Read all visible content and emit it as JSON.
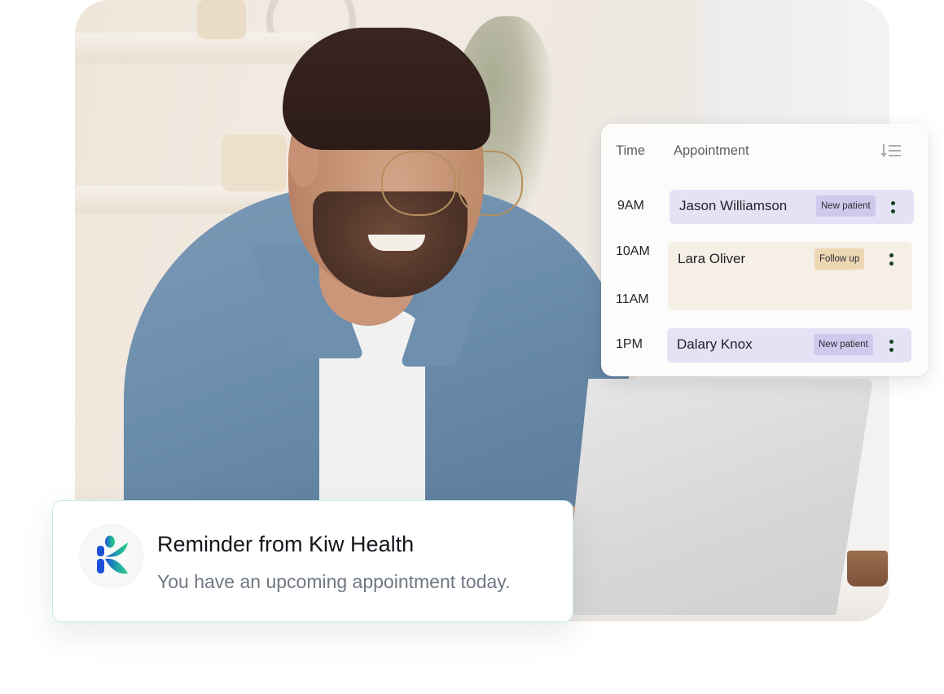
{
  "schedule": {
    "headers": {
      "time": "Time",
      "appointment": "Appointment"
    },
    "sort_icon": "sort-descending-icon",
    "time_labels": [
      "9AM",
      "10AM",
      "11AM",
      "1PM"
    ],
    "appointments": [
      {
        "time": "9AM",
        "patient": "Jason Williamson",
        "tag": "New patient",
        "tag_color": "#d0c9ec",
        "row_color": "#e4e2f5"
      },
      {
        "time": "10AM",
        "end_time": "11AM",
        "patient": "Lara Oliver",
        "tag": "Follow up",
        "tag_color": "#efd6b3",
        "row_color": "#f5efe6"
      },
      {
        "time": "1PM",
        "patient": "Dalary Knox",
        "tag": "New patient",
        "tag_color": "#d0c9ec",
        "row_color": "#e4e2f5"
      }
    ],
    "menu_icon": "more-vertical-icon"
  },
  "reminder": {
    "logo_icon": "kiw-health-logo",
    "title": "Reminder from Kiw Health",
    "message": "You have an upcoming appointment today."
  },
  "colors": {
    "brand_blue": "#1c4fd8",
    "brand_green": "#2fd08a",
    "menu_dot": "#17401f"
  }
}
